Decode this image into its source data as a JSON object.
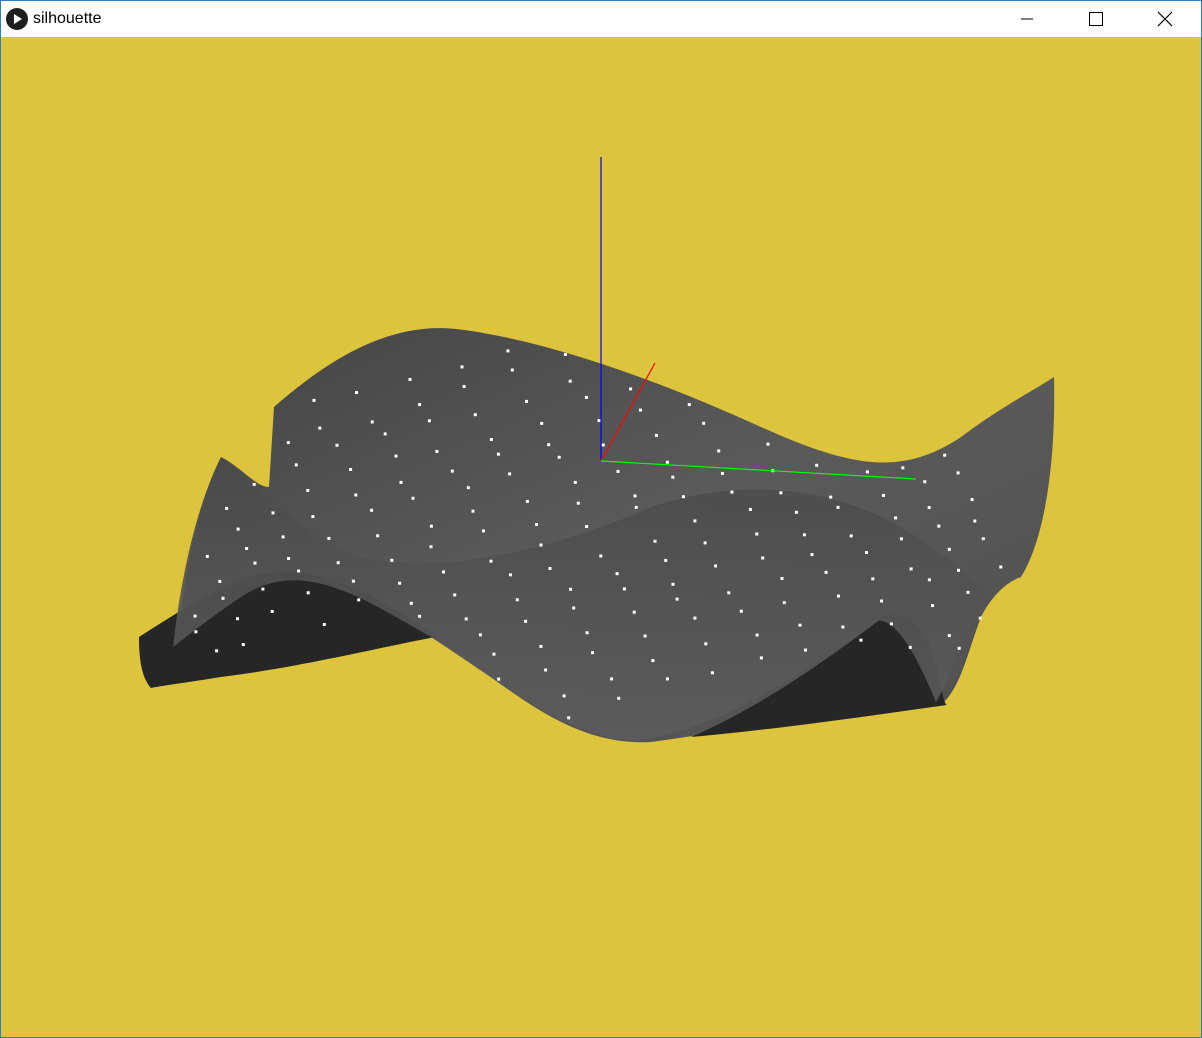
{
  "window": {
    "title": "silhouette",
    "app_icon": "play-circle-icon",
    "controls": [
      "minimize-icon",
      "maximize-icon",
      "close-icon"
    ]
  },
  "scene": {
    "background_color": "#DCC43C",
    "surface_light_color": "#5a5a5a",
    "surface_dark_color": "#262626",
    "point_color": "#ffffff",
    "axes": {
      "x_color": "#ff0000",
      "y_color": "#00ff00",
      "z_color": "#0000ff"
    }
  }
}
